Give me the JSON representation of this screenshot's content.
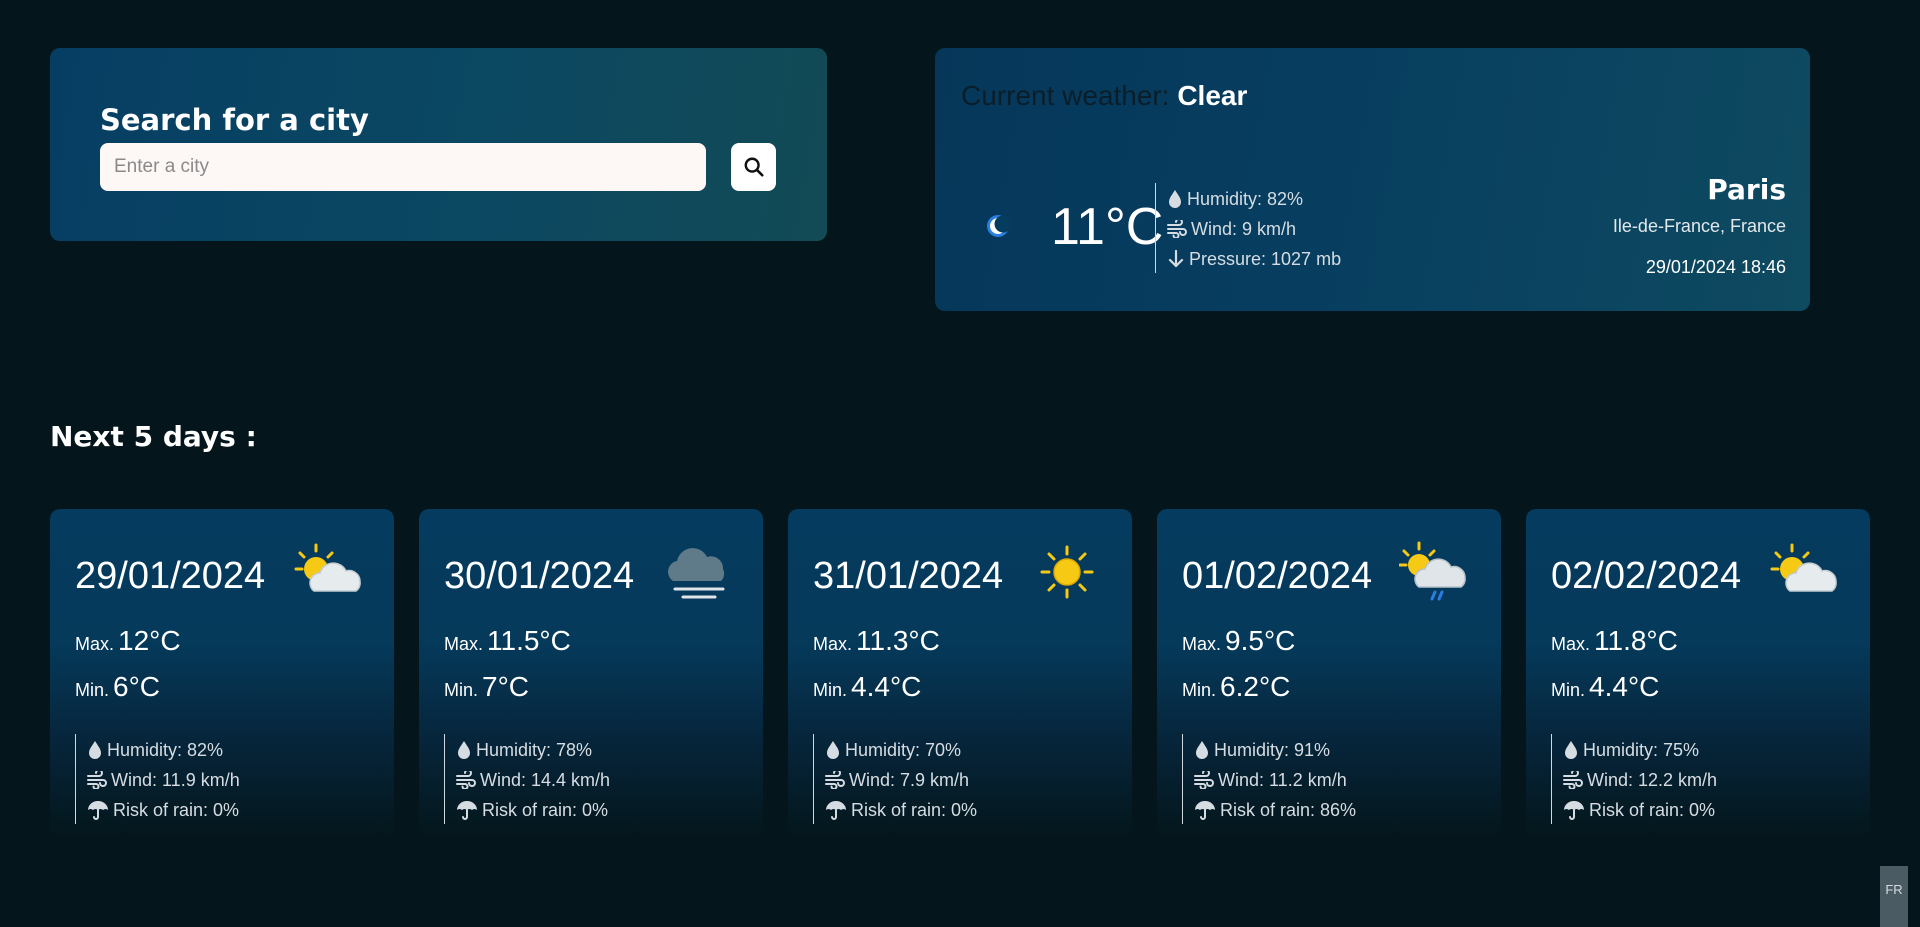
{
  "search": {
    "title": "Search for a city",
    "placeholder": "Enter a city",
    "value": ""
  },
  "current": {
    "label": "Current weather:",
    "condition": "Clear",
    "temp": "11°C",
    "humidity": "Humidity: 82%",
    "wind": "Wind: 9 km/h",
    "pressure": "Pressure: 1027 mb",
    "city": "Paris",
    "region": "Ile-de-France, France",
    "datetime": "29/01/2024 18:46",
    "icon": "moon-icon"
  },
  "forecast": {
    "heading": "Next 5 days :",
    "max_label": "Max.",
    "min_label": "Min.",
    "days": [
      {
        "date": "29/01/2024",
        "icon": "partly-cloudy-icon",
        "max": "12°C",
        "min": "6°C",
        "humidity": "Humidity: 82%",
        "wind": "Wind: 11.9 km/h",
        "rain": "Risk of rain: 0%"
      },
      {
        "date": "30/01/2024",
        "icon": "fog-icon",
        "max": "11.5°C",
        "min": "7°C",
        "humidity": "Humidity: 78%",
        "wind": "Wind: 14.4 km/h",
        "rain": "Risk of rain: 0%"
      },
      {
        "date": "31/01/2024",
        "icon": "sun-icon",
        "max": "11.3°C",
        "min": "4.4°C",
        "humidity": "Humidity: 70%",
        "wind": "Wind: 7.9 km/h",
        "rain": "Risk of rain: 0%"
      },
      {
        "date": "01/02/2024",
        "icon": "sun-cloud-rain-icon",
        "max": "9.5°C",
        "min": "6.2°C",
        "humidity": "Humidity: 91%",
        "wind": "Wind: 11.2 km/h",
        "rain": "Risk of rain: 86%"
      },
      {
        "date": "02/02/2024",
        "icon": "partly-cloudy-icon",
        "max": "11.8°C",
        "min": "4.4°C",
        "humidity": "Humidity: 75%",
        "wind": "Wind: 12.2 km/h",
        "rain": "Risk of rain: 0%"
      }
    ]
  },
  "language": "FR",
  "colors": {
    "background": "#04161b",
    "card": "#063e63",
    "sun": "#f6c915",
    "cloud": "#e6ebee",
    "rain": "#2a7de1"
  }
}
